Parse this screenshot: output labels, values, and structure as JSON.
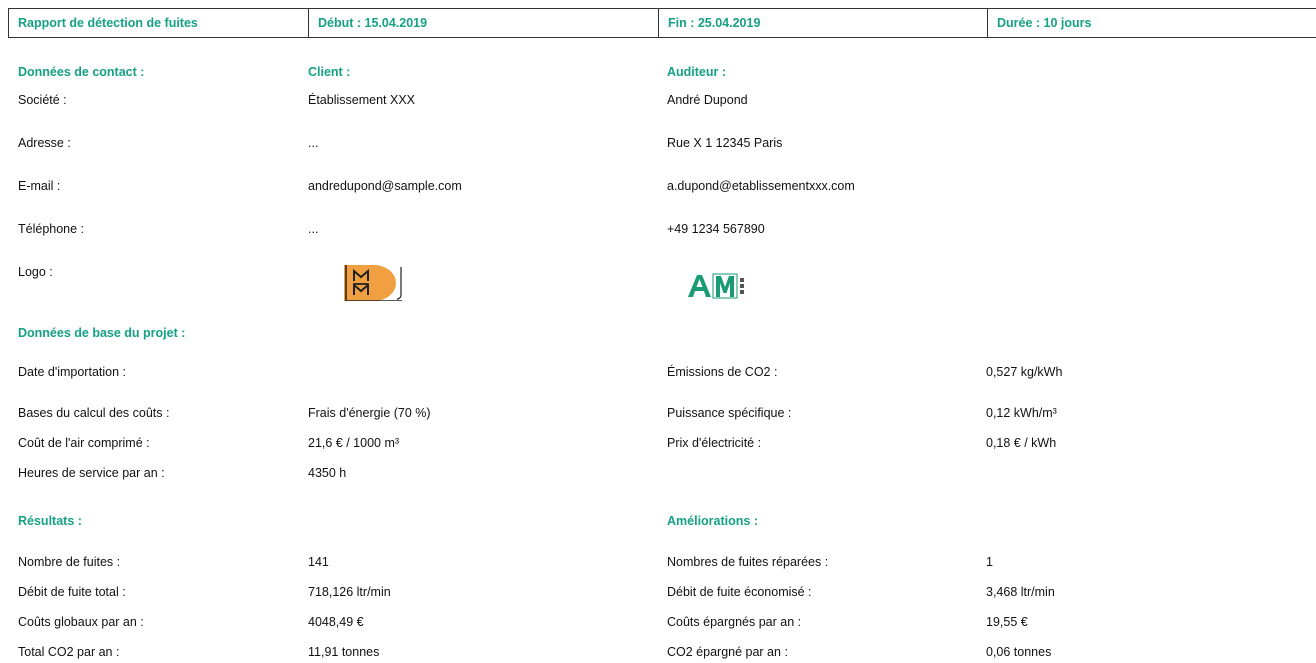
{
  "header": {
    "title": "Rapport de détection de fuites",
    "start": "Début  : 15.04.2019",
    "end": "Fin  : 25.04.2019",
    "duration": "Durée  : 10 jours"
  },
  "contact": {
    "heading": "Données de contact  :",
    "client_heading": "Client  :",
    "auditor_heading": "Auditeur  :",
    "rows": [
      {
        "label": "Société  :",
        "client": "Établissement XXX",
        "auditor": "André Dupond"
      },
      {
        "label": "Adresse  :",
        "client": "...",
        "auditor": "Rue X 1 12345 Paris"
      },
      {
        "label": "E-mail  :",
        "client": "andredupond@sample.com",
        "auditor": "a.dupond@etablissementxxx.com"
      },
      {
        "label": "Téléphone  :",
        "client": "...",
        "auditor": "+49 1234 567890"
      }
    ],
    "logo_label": "Logo  :",
    "client_logo_text": "MM",
    "auditor_logo_text": "AM"
  },
  "project": {
    "heading": "Données de base du projet  :",
    "rows": [
      {
        "label": "Date d'importation  :",
        "value": "",
        "label2": "Émissions de CO2  :",
        "value2": "0,527 kg/kWh"
      },
      {
        "label": "Bases du calcul des coûts  :",
        "value": "Frais d'énergie (70 %)",
        "label2": "Puissance spécifique  :",
        "value2": "0,12 kWh/m³"
      },
      {
        "label": "Coût de l'air comprimé  :",
        "value": "21,6 € / 1000 m³",
        "label2": "Prix d'électricité  :",
        "value2": "0,18 € / kWh"
      },
      {
        "label": "Heures de service par an  :",
        "value": "4350 h",
        "label2": "",
        "value2": ""
      }
    ]
  },
  "results": {
    "heading": "Résultats  :",
    "improvements_heading": "Améliorations  :",
    "rows": [
      {
        "label": "Nombre de fuites  :",
        "value": "141",
        "label2": "Nombres de fuites réparées  :",
        "value2": "1"
      },
      {
        "label": "Débit de fuite total  :",
        "value": "718,126 ltr/min",
        "label2": "Débit de fuite économisé  :",
        "value2": "3,468 ltr/min"
      },
      {
        "label": "Coûts globaux par an  :",
        "value": "4048,49 €",
        "label2": "Coûts épargnés par an  :",
        "value2": "19,55 €"
      },
      {
        "label": "Total CO2 par an  :",
        "value": "11,91 tonnes",
        "label2": "CO2 épargné par an  :",
        "value2": "0,06 tonnes"
      }
    ]
  },
  "colors": {
    "accent": "#16a085",
    "logo_orange": "#f0a040",
    "logo_green": "#1a9b74"
  }
}
